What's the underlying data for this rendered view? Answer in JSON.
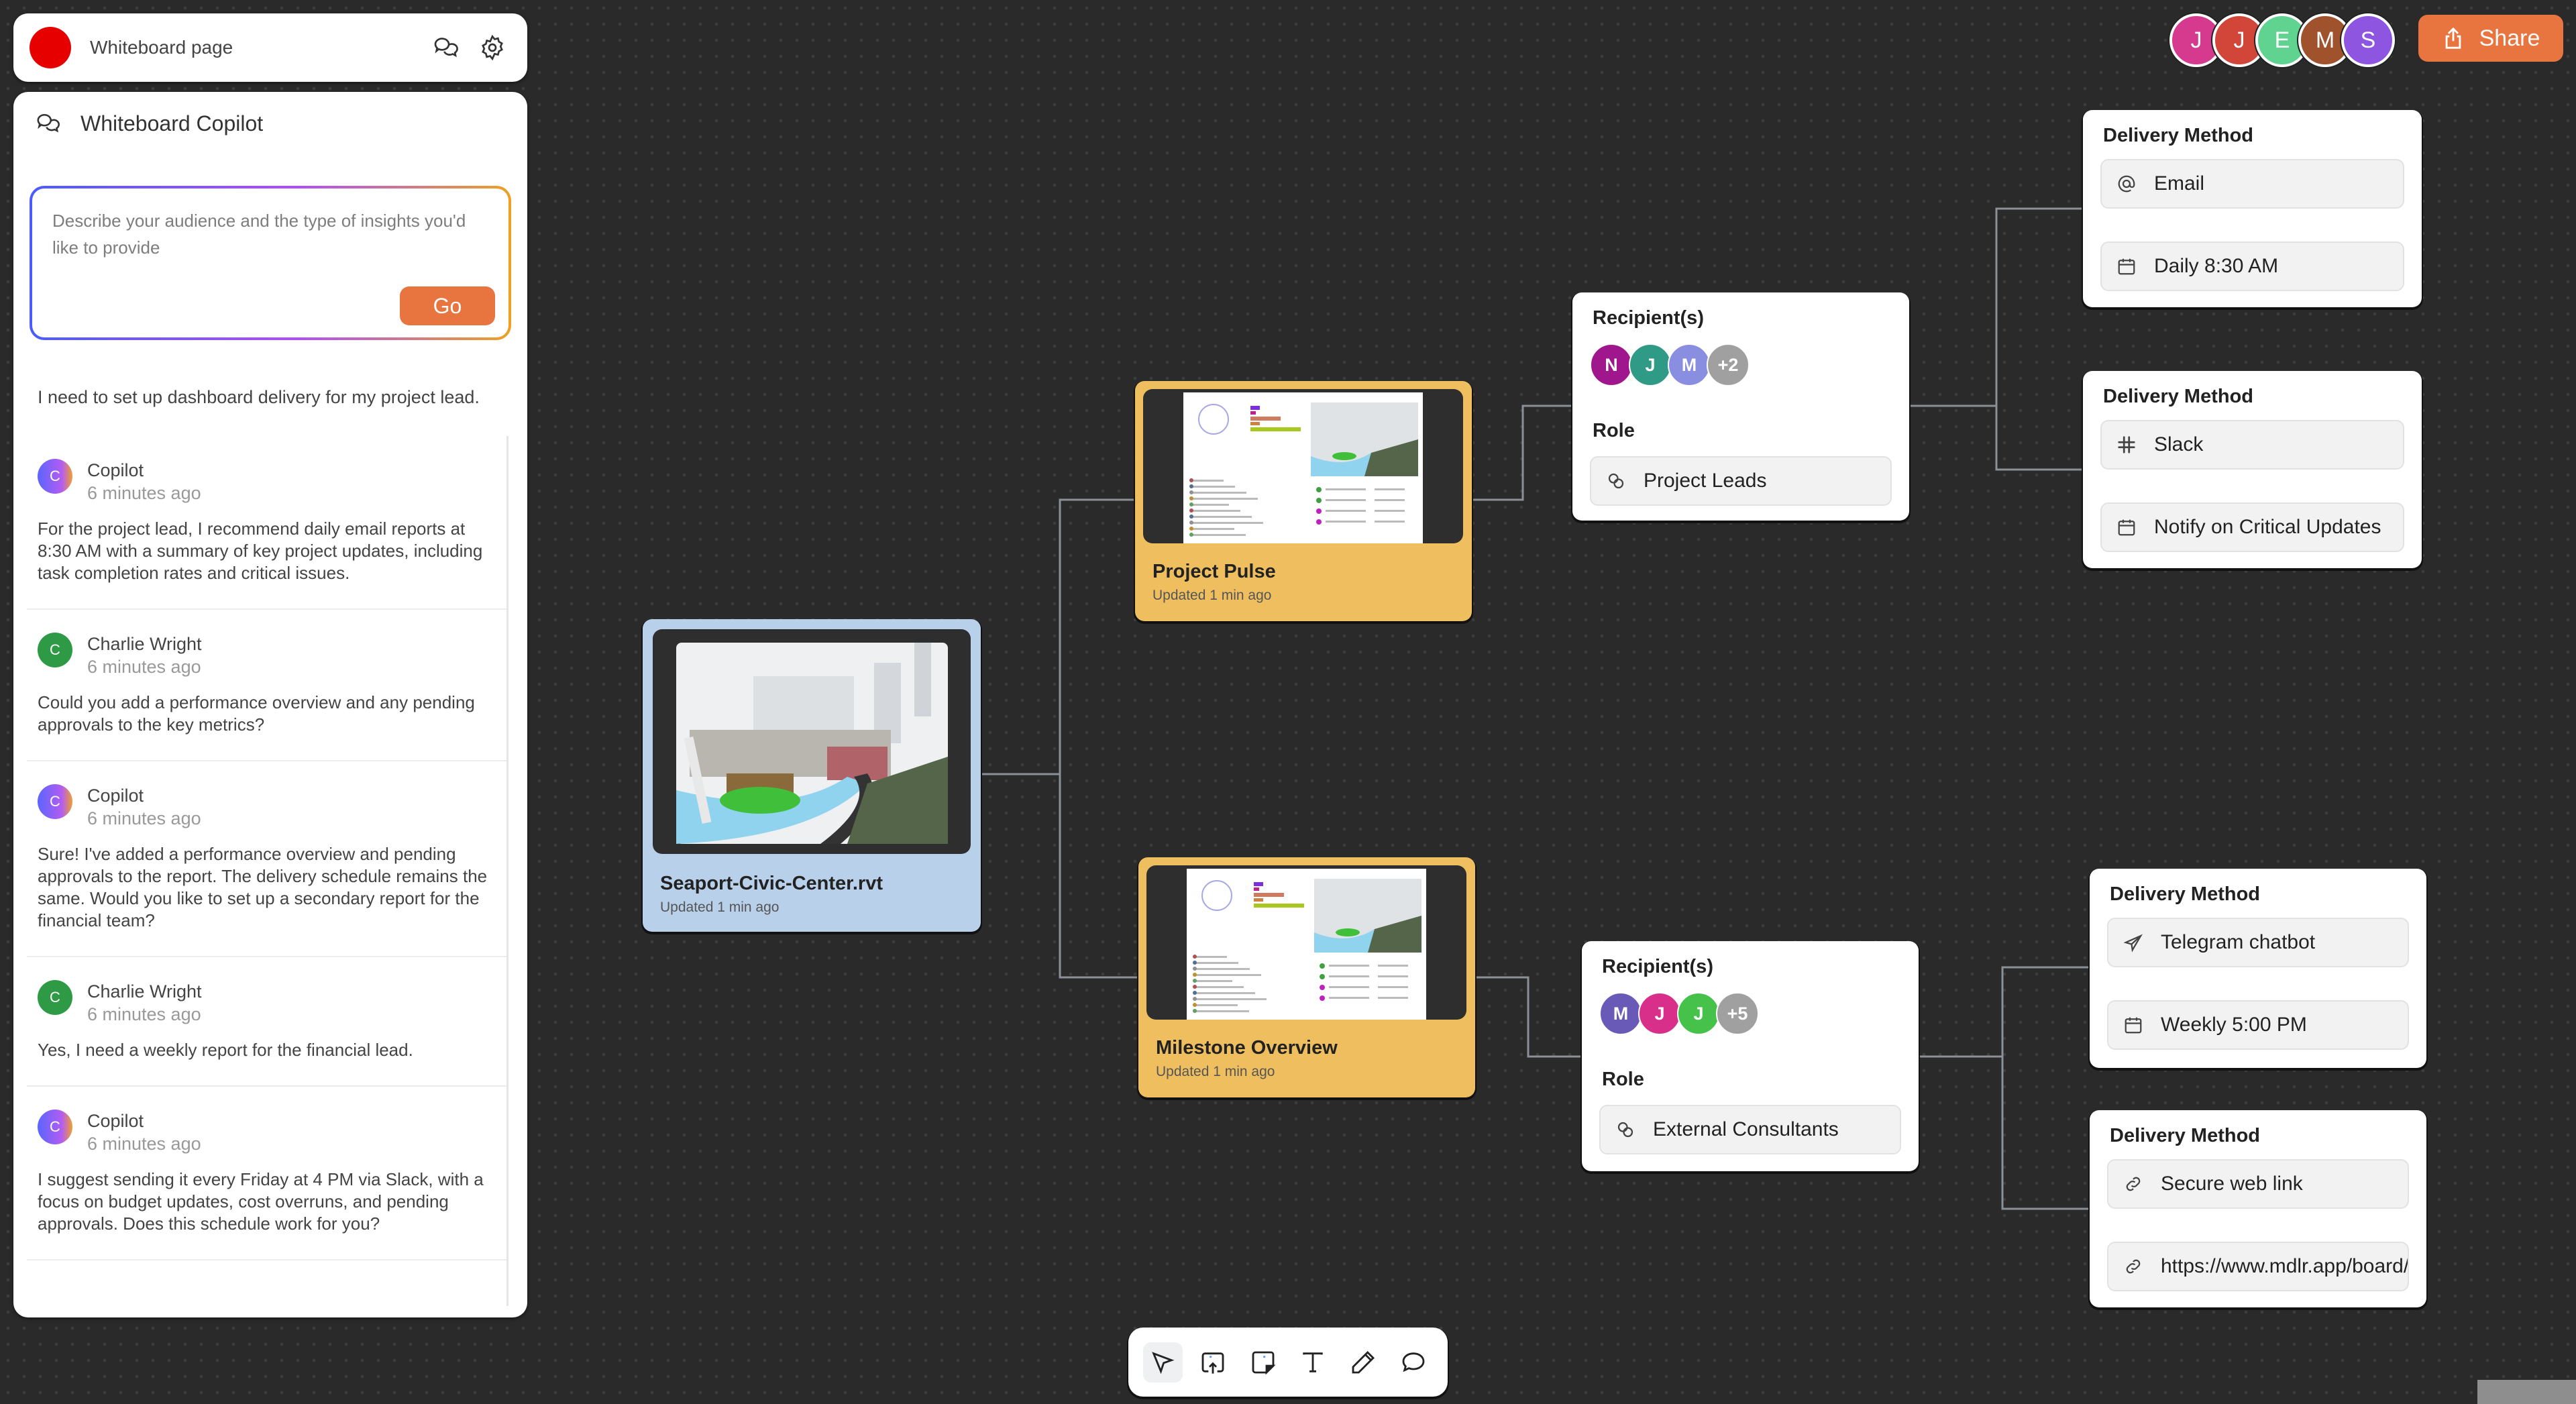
{
  "header": {
    "title": "Whiteboard page",
    "icons": [
      "logo-red-circle",
      "chat-bubbles-icon",
      "gear-icon"
    ]
  },
  "copilot": {
    "title": "Whiteboard Copilot",
    "prompt_placeholder": "Describe your audience and the type of insights you'd like to provide",
    "prompt_value": "",
    "go_label": "Go",
    "user_message": "I need to set up dashboard delivery for my project lead.",
    "messages": [
      {
        "initial": "C",
        "author": "Copilot",
        "time": "6 minutes ago",
        "text": "For the project lead, I recommend daily email reports at 8:30 AM with a summary of key project updates, including task completion rates and critical issues."
      },
      {
        "initial": "C",
        "author": "Charlie Wright",
        "time": "6 minutes ago",
        "text": "Could you add a performance overview and any pending approvals to the key metrics?"
      },
      {
        "initial": "C",
        "author": "Copilot",
        "time": "6 minutes ago",
        "text": "Sure! I've added a performance overview and pending approvals to the report. The delivery schedule remains the same. Would you like to set up a secondary report for the financial team?"
      },
      {
        "initial": "C",
        "author": "Charlie Wright",
        "time": "6 minutes ago",
        "text": "Yes, I need a weekly report for the financial lead."
      },
      {
        "initial": "C",
        "author": "Copilot",
        "time": "6 minutes ago",
        "text": "I suggest sending it every Friday at 4 PM via Slack, with a focus on budget updates, cost overruns, and pending approvals. Does this schedule work for you?"
      }
    ]
  },
  "collaborators": [
    {
      "initial": "J",
      "color": "#d63a8f"
    },
    {
      "initial": "J",
      "color": "#d2463a"
    },
    {
      "initial": "E",
      "color": "#5fd38f"
    },
    {
      "initial": "M",
      "color": "#a0522d"
    },
    {
      "initial": "S",
      "color": "#8e55e0"
    }
  ],
  "share_label": "Share",
  "accent_color": "#e8743f",
  "nodes": {
    "source": {
      "title": "Seaport-Civic-Center.rvt",
      "subtitle": "Updated 1 min ago",
      "color": "#b8d0ea"
    },
    "dash1": {
      "title": "Project Pulse",
      "subtitle": "Updated 1 min ago",
      "color": "#efbf5f"
    },
    "dash2": {
      "title": "Milestone Overview",
      "subtitle": "Updated 1 min ago",
      "color": "#efbf5f"
    },
    "recip1": {
      "label": "Recipient(s)",
      "avatars": [
        {
          "initial": "N",
          "color": "#a0168c"
        },
        {
          "initial": "J",
          "color": "#2f9a85"
        },
        {
          "initial": "M",
          "color": "#8a8ee0"
        },
        {
          "initial": "+2",
          "color": "#a0a0a0"
        }
      ],
      "role_label": "Role",
      "role": "Project Leads"
    },
    "recip2": {
      "label": "Recipient(s)",
      "avatars": [
        {
          "initial": "M",
          "color": "#6a5ab8"
        },
        {
          "initial": "J",
          "color": "#d8308a"
        },
        {
          "initial": "J",
          "color": "#46c24a"
        },
        {
          "initial": "+5",
          "color": "#a0a0a0"
        }
      ],
      "role_label": "Role",
      "role": "External Consultants"
    },
    "delivery1": {
      "label": "Delivery Method",
      "method": "Email",
      "method_icon": "at-icon",
      "schedule": "Daily 8:30 AM",
      "schedule_icon": "calendar-icon"
    },
    "delivery2": {
      "label": "Delivery Method",
      "method": "Slack",
      "method_icon": "slack-icon",
      "schedule": "Notify on Critical Updates",
      "schedule_icon": "calendar-icon"
    },
    "delivery3": {
      "label": "Delivery Method",
      "method": "Telegram chatbot",
      "method_icon": "send-icon",
      "schedule": "Weekly 5:00 PM",
      "schedule_icon": "calendar-icon"
    },
    "delivery4": {
      "label": "Delivery Method",
      "method": "Secure web link",
      "method_icon": "link-icon",
      "schedule": "https://www.mdlr.app/board/F",
      "schedule_icon": "link-icon"
    }
  },
  "toolbar": {
    "tools": [
      "select",
      "upload-image",
      "sticky-note",
      "text",
      "pen",
      "comment"
    ],
    "active": "select"
  }
}
